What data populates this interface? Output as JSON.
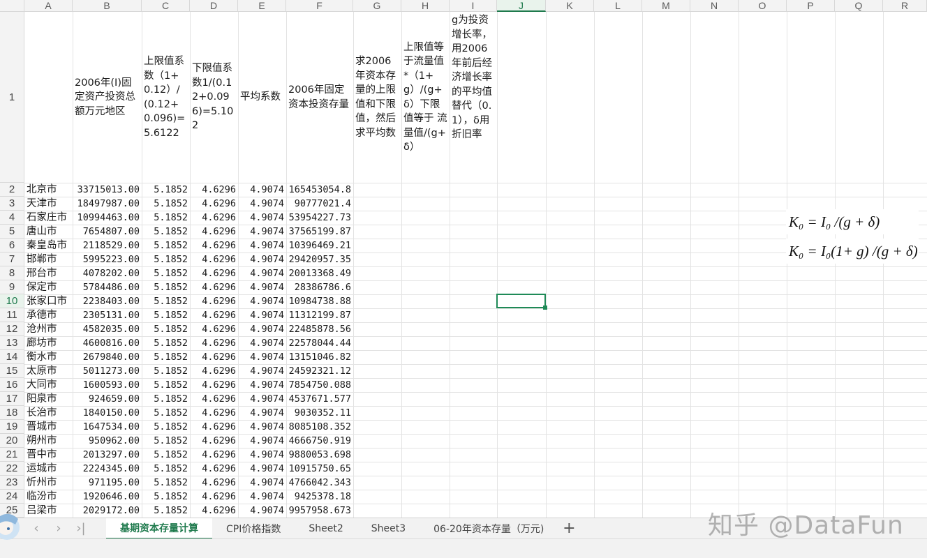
{
  "columns": [
    "A",
    "B",
    "C",
    "D",
    "E",
    "F",
    "G",
    "H",
    "I",
    "J",
    "K",
    "L",
    "M",
    "N",
    "O",
    "P",
    "Q",
    "R"
  ],
  "active_column": "J",
  "row_numbers": [
    "1",
    "2",
    "3",
    "4",
    "5",
    "6",
    "7",
    "8",
    "9",
    "10",
    "11",
    "12",
    "13",
    "14",
    "15",
    "16",
    "17",
    "18",
    "19",
    "20",
    "21",
    "22",
    "23",
    "24",
    "25"
  ],
  "active_row": "10",
  "header_cells": {
    "B": "2006年(I)固定资产投资总额万元地区",
    "C": "上限值系数（1+0.12）/(0.12+0.096)=5.6122",
    "D": "下限值系数1/(0.12+0.096)=5.102",
    "E": "平均系数",
    "F": "2006年固定资本投资存量",
    "G": "求2006年资本存量的上限值和下限值，然后求平均数",
    "H": "上限值等于流量值*（1+g）/(g+δ）下限值等于 流量值/(g+δ）",
    "I": "g为投资增长率，用2006年前后经济增长率的平均值替代（0.1），δ用折旧率"
  },
  "rows": [
    {
      "city": "北京市",
      "inv": "33715013.00",
      "c": "5.1852",
      "d": "4.6296",
      "e": "4.9074",
      "f": "165453054.8"
    },
    {
      "city": "天津市",
      "inv": "18497987.00",
      "c": "5.1852",
      "d": "4.6296",
      "e": "4.9074",
      "f": "90777021.4"
    },
    {
      "city": "石家庄市",
      "inv": "10994463.00",
      "c": "5.1852",
      "d": "4.6296",
      "e": "4.9074",
      "f": "53954227.73"
    },
    {
      "city": "唐山市",
      "inv": "7654807.00",
      "c": "5.1852",
      "d": "4.6296",
      "e": "4.9074",
      "f": "37565199.87"
    },
    {
      "city": "秦皇岛市",
      "inv": "2118529.00",
      "c": "5.1852",
      "d": "4.6296",
      "e": "4.9074",
      "f": "10396469.21"
    },
    {
      "city": "邯郸市",
      "inv": "5995223.00",
      "c": "5.1852",
      "d": "4.6296",
      "e": "4.9074",
      "f": "29420957.35"
    },
    {
      "city": "邢台市",
      "inv": "4078202.00",
      "c": "5.1852",
      "d": "4.6296",
      "e": "4.9074",
      "f": "20013368.49"
    },
    {
      "city": "保定市",
      "inv": "5784486.00",
      "c": "5.1852",
      "d": "4.6296",
      "e": "4.9074",
      "f": "28386786.6"
    },
    {
      "city": "张家口市",
      "inv": "2238403.00",
      "c": "5.1852",
      "d": "4.6296",
      "e": "4.9074",
      "f": "10984738.88"
    },
    {
      "city": "承德市",
      "inv": "2305131.00",
      "c": "5.1852",
      "d": "4.6296",
      "e": "4.9074",
      "f": "11312199.87"
    },
    {
      "city": "沧州市",
      "inv": "4582035.00",
      "c": "5.1852",
      "d": "4.6296",
      "e": "4.9074",
      "f": "22485878.56"
    },
    {
      "city": "廊坊市",
      "inv": "4600816.00",
      "c": "5.1852",
      "d": "4.6296",
      "e": "4.9074",
      "f": "22578044.44"
    },
    {
      "city": "衡水市",
      "inv": "2679840.00",
      "c": "5.1852",
      "d": "4.6296",
      "e": "4.9074",
      "f": "13151046.82"
    },
    {
      "city": "太原市",
      "inv": "5011273.00",
      "c": "5.1852",
      "d": "4.6296",
      "e": "4.9074",
      "f": "24592321.12"
    },
    {
      "city": "大同市",
      "inv": "1600593.00",
      "c": "5.1852",
      "d": "4.6296",
      "e": "4.9074",
      "f": "7854750.088"
    },
    {
      "city": "阳泉市",
      "inv": "924659.00",
      "c": "5.1852",
      "d": "4.6296",
      "e": "4.9074",
      "f": "4537671.577"
    },
    {
      "city": "长治市",
      "inv": "1840150.00",
      "c": "5.1852",
      "d": "4.6296",
      "e": "4.9074",
      "f": "9030352.11"
    },
    {
      "city": "晋城市",
      "inv": "1647534.00",
      "c": "5.1852",
      "d": "4.6296",
      "e": "4.9074",
      "f": "8085108.352"
    },
    {
      "city": "朔州市",
      "inv": "950962.00",
      "c": "5.1852",
      "d": "4.6296",
      "e": "4.9074",
      "f": "4666750.919"
    },
    {
      "city": "晋中市",
      "inv": "2013297.00",
      "c": "5.1852",
      "d": "4.6296",
      "e": "4.9074",
      "f": "9880053.698"
    },
    {
      "city": "运城市",
      "inv": "2224345.00",
      "c": "5.1852",
      "d": "4.6296",
      "e": "4.9074",
      "f": "10915750.65"
    },
    {
      "city": "忻州市",
      "inv": "971195.00",
      "c": "5.1852",
      "d": "4.6296",
      "e": "4.9074",
      "f": "4766042.343"
    },
    {
      "city": "临汾市",
      "inv": "1920646.00",
      "c": "5.1852",
      "d": "4.6296",
      "e": "4.9074",
      "f": "9425378.18"
    },
    {
      "city": "吕梁市",
      "inv": "2029172.00",
      "c": "5.1852",
      "d": "4.6296",
      "e": "4.9074",
      "f": "9957958.673"
    }
  ],
  "formulas": {
    "lower": "K₀ = I₀ /(g + δ)",
    "upper": "K₀ = I₀(1+ g) /(g + δ)"
  },
  "sheet_tabs": [
    "基期资本存量计算",
    "CPI价格指数",
    "Sheet2",
    "Sheet3",
    "06-20年资本存量（万元)"
  ],
  "active_tab": "基期资本存量计算",
  "watermark": "知乎 @DataFun",
  "colors": {
    "accent": "#1f7a4d",
    "selection": "#1f8a57",
    "gridline": "#e3e3e3"
  }
}
